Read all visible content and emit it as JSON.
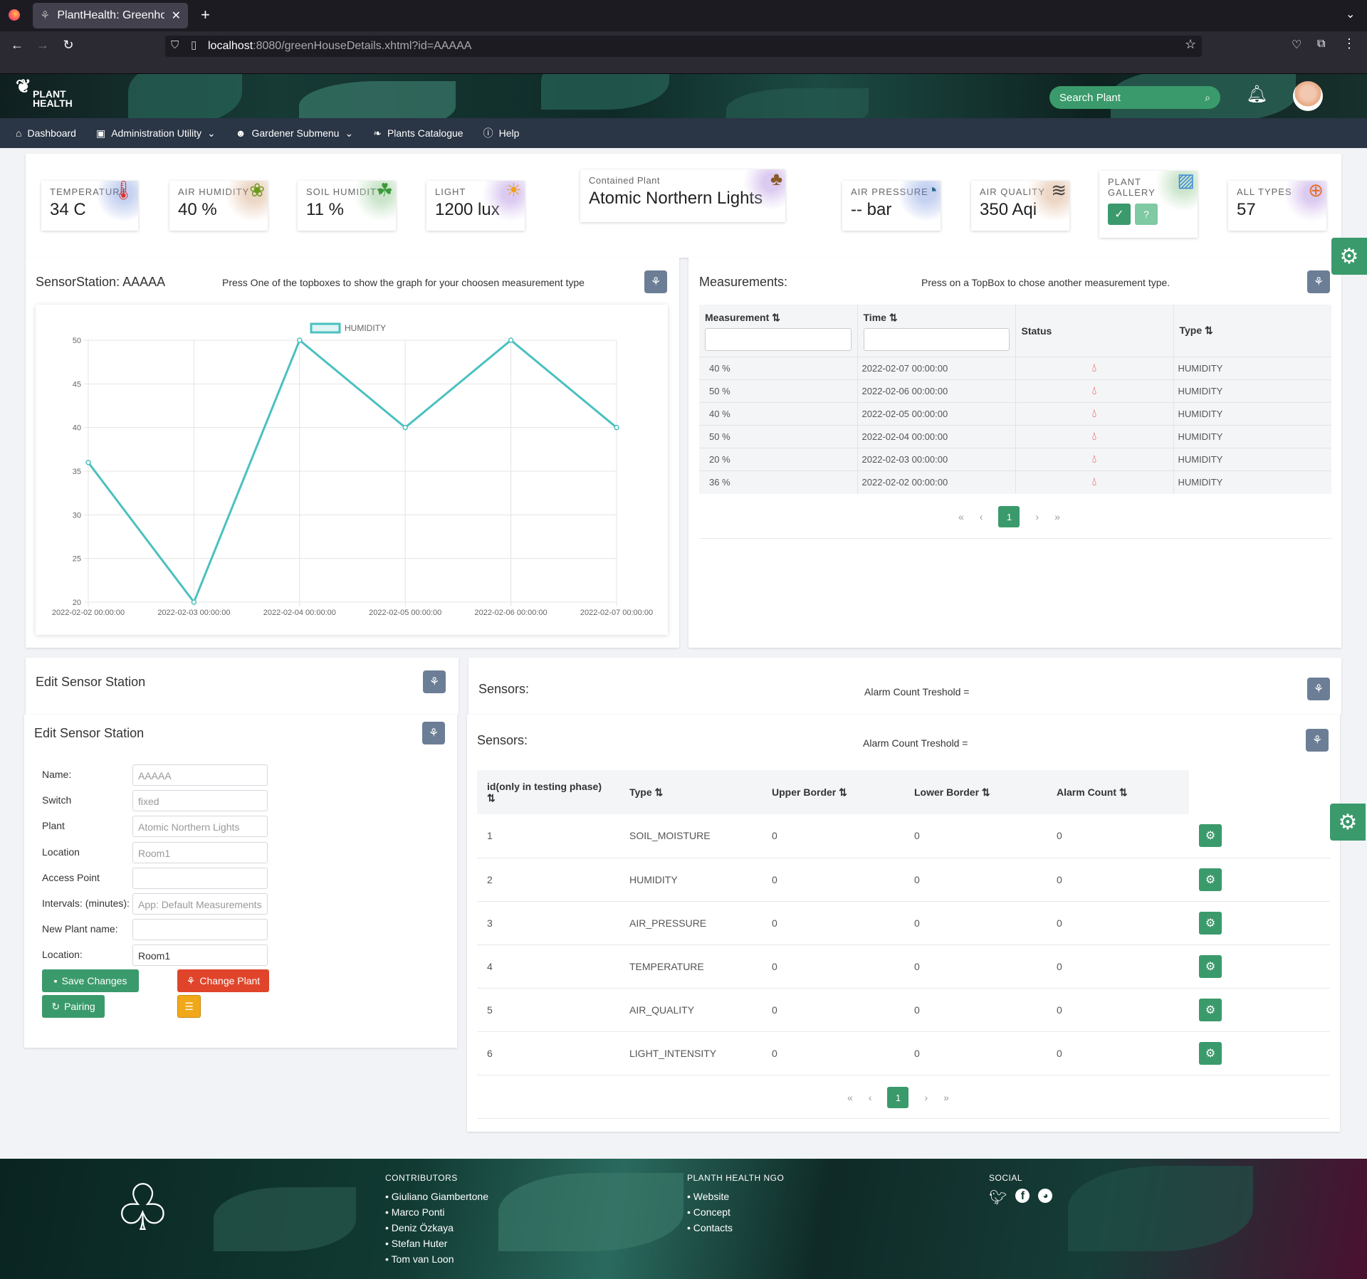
{
  "browser": {
    "tab_title": "PlantHealth: Greenhous",
    "url_host": "localhost",
    "url_rest": ":8080/greenHouseDetails.xhtml?id=AAAAA"
  },
  "header": {
    "logo_line1": "PLANT",
    "logo_line2": "HEALTH",
    "search_placeholder": "Search Plant"
  },
  "menu": {
    "dashboard": "Dashboard",
    "admin": "Administration Utility",
    "gardener": "Gardener Submenu",
    "catalogue": "Plants Catalogue",
    "help": "Help"
  },
  "topboxes": {
    "temperature": {
      "label": "TEMPERATURE",
      "value": "34 C"
    },
    "air_humidity": {
      "label": "AIR HUMIDITY",
      "value": "40 %"
    },
    "soil_humidity": {
      "label": "SOIL HUMIDITY",
      "value": "11 %"
    },
    "light": {
      "label": "LIGHT",
      "value": "1200 lux"
    },
    "contained_plant": {
      "label": "Contained Plant",
      "value": "Atomic Northern Lights"
    },
    "air_pressure": {
      "label": "AIR PRESSURE",
      "value": "-- bar"
    },
    "air_quality": {
      "label": "AIR QUALITY",
      "value": "350 Aqi"
    },
    "gallery": {
      "label1": "PLANT",
      "label2": "GALLERY",
      "q": "?"
    },
    "all_types": {
      "label": "ALL TYPES",
      "value": "57"
    }
  },
  "sensor_panel": {
    "title": "SensorStation: AAAAA",
    "hint": "Press One of the topboxes to show the graph for your choosen measurement type"
  },
  "chart_data": {
    "type": "line",
    "series": [
      {
        "name": "HUMIDITY",
        "values": [
          36,
          20,
          50,
          40,
          50,
          40
        ]
      }
    ],
    "categories": [
      "2022-02-02 00:00:00",
      "2022-02-03 00:00:00",
      "2022-02-04 00:00:00",
      "2022-02-05 00:00:00",
      "2022-02-06 00:00:00",
      "2022-02-07 00:00:00"
    ],
    "yticks": [
      "50",
      "45",
      "40",
      "35",
      "30",
      "25",
      "20"
    ],
    "ylim": [
      20,
      50
    ],
    "color": "#4bc0c0",
    "grid": true,
    "legend": "top"
  },
  "measurements": {
    "title": "Measurements:",
    "hint": "Press on a TopBox to chose another measurement type.",
    "headers": {
      "measurement": "Measurement",
      "time": "Time",
      "status": "Status",
      "type": "Type"
    },
    "rows": [
      [
        "40 %",
        "2022-02-07 00:00:00",
        "HUMIDITY"
      ],
      [
        "50 %",
        "2022-02-06 00:00:00",
        "HUMIDITY"
      ],
      [
        "40 %",
        "2022-02-05 00:00:00",
        "HUMIDITY"
      ],
      [
        "50 %",
        "2022-02-04 00:00:00",
        "HUMIDITY"
      ],
      [
        "20 %",
        "2022-02-03 00:00:00",
        "HUMIDITY"
      ],
      [
        "36 %",
        "2022-02-02 00:00:00",
        "HUMIDITY"
      ]
    ],
    "page": "1"
  },
  "edit": {
    "title_outer": "Edit Sensor Station",
    "title": "Edit Sensor Station",
    "fields": [
      {
        "label": "Name:",
        "value": "AAAAA"
      },
      {
        "label": "Switch",
        "value": "fixed"
      },
      {
        "label": "Plant",
        "value": "Atomic Northern Lights"
      },
      {
        "label": "Location",
        "value": "Room1"
      },
      {
        "label": "Access Point",
        "value": ""
      },
      {
        "label": "Intervals: (minutes):",
        "value": "App: Default Measurements"
      },
      {
        "label": "New Plant name:",
        "value": ""
      },
      {
        "label": "Location:",
        "value": "Room1"
      }
    ],
    "save": "Save Changes",
    "change": "Change Plant",
    "pairing": "Pairing"
  },
  "sensors": {
    "title_outer": "Sensors:",
    "alarm_outer": "Alarm Count Treshold =",
    "title": "Sensors:",
    "alarm": "Alarm Count Treshold =",
    "headers": {
      "id": "id(only in testing phase)",
      "type": "Type",
      "upper": "Upper Border",
      "lower": "Lower Border",
      "alarm": "Alarm Count"
    },
    "rows": [
      [
        "1",
        "SOIL_MOISTURE",
        "0",
        "0",
        "0"
      ],
      [
        "2",
        "HUMIDITY",
        "0",
        "0",
        "0"
      ],
      [
        "3",
        "AIR_PRESSURE",
        "0",
        "0",
        "0"
      ],
      [
        "4",
        "TEMPERATURE",
        "0",
        "0",
        "0"
      ],
      [
        "5",
        "AIR_QUALITY",
        "0",
        "0",
        "0"
      ],
      [
        "6",
        "LIGHT_INTENSITY",
        "0",
        "0",
        "0"
      ]
    ],
    "page": "1"
  },
  "footer": {
    "contrib_title": "CONTRIBUTORS",
    "contributors": [
      "Giuliano Giambertone",
      "Marco Ponti",
      "Deniz Özkaya",
      "Stefan Huter",
      "Tom van Loon"
    ],
    "ngo_title": "PLANTH HEALTH NGO",
    "ngo": [
      "Website",
      "Concept",
      "Contacts"
    ],
    "social_title": "SOCIAL"
  }
}
